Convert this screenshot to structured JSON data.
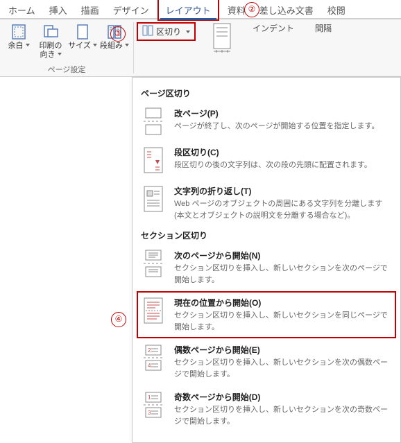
{
  "tabs": {
    "t0": "ホーム",
    "t1": "挿入",
    "t2": "描画",
    "t3": "デザイン",
    "t4": "レイアウト",
    "t5": "参考資料",
    "t5_visible": "資料",
    "t6": "差し込み文書",
    "t7": "校閲"
  },
  "annotations": {
    "a2": "②",
    "a3": "③",
    "a4": "④"
  },
  "pageSetup": {
    "margins": "余白",
    "orientation": "印刷の\n向き",
    "size": "サイズ",
    "columns": "段組み",
    "groupLabel": "ページ設定",
    "breaks": "区切り"
  },
  "rightStubs": {
    "indent": "インデント",
    "spacing": "間隔"
  },
  "dropdown": {
    "pageBreaksHeader": "ページ区切り",
    "sectionBreaksHeader": "セクション区切り",
    "item_page": {
      "title": "改ページ(P)",
      "desc": "ページが終了し、次のページが開始する位置を指定します。"
    },
    "item_column": {
      "title": "段区切り(C)",
      "desc": "段区切りの後の文字列は、次の段の先頭に配置されます。"
    },
    "item_wrap": {
      "title": "文字列の折り返し(T)",
      "desc": "Web ページのオブジェクトの周囲にある文字列を分離します (本文とオブジェクトの説明文を分離する場合など)。"
    },
    "item_next": {
      "title": "次のページから開始(N)",
      "desc": "セクション区切りを挿入し、新しいセクションを次のページで開始します。"
    },
    "item_cont": {
      "title": "現在の位置から開始(O)",
      "desc": "セクション区切りを挿入し、新しいセクションを同じページで開始します。"
    },
    "item_even": {
      "title": "偶数ページから開始(E)",
      "desc": "セクション区切りを挿入し、新しいセクションを次の偶数ページで開始します。"
    },
    "item_odd": {
      "title": "奇数ページから開始(D)",
      "desc": "セクション区切りを挿入し、新しいセクションを次の奇数ページで開始します。"
    }
  }
}
